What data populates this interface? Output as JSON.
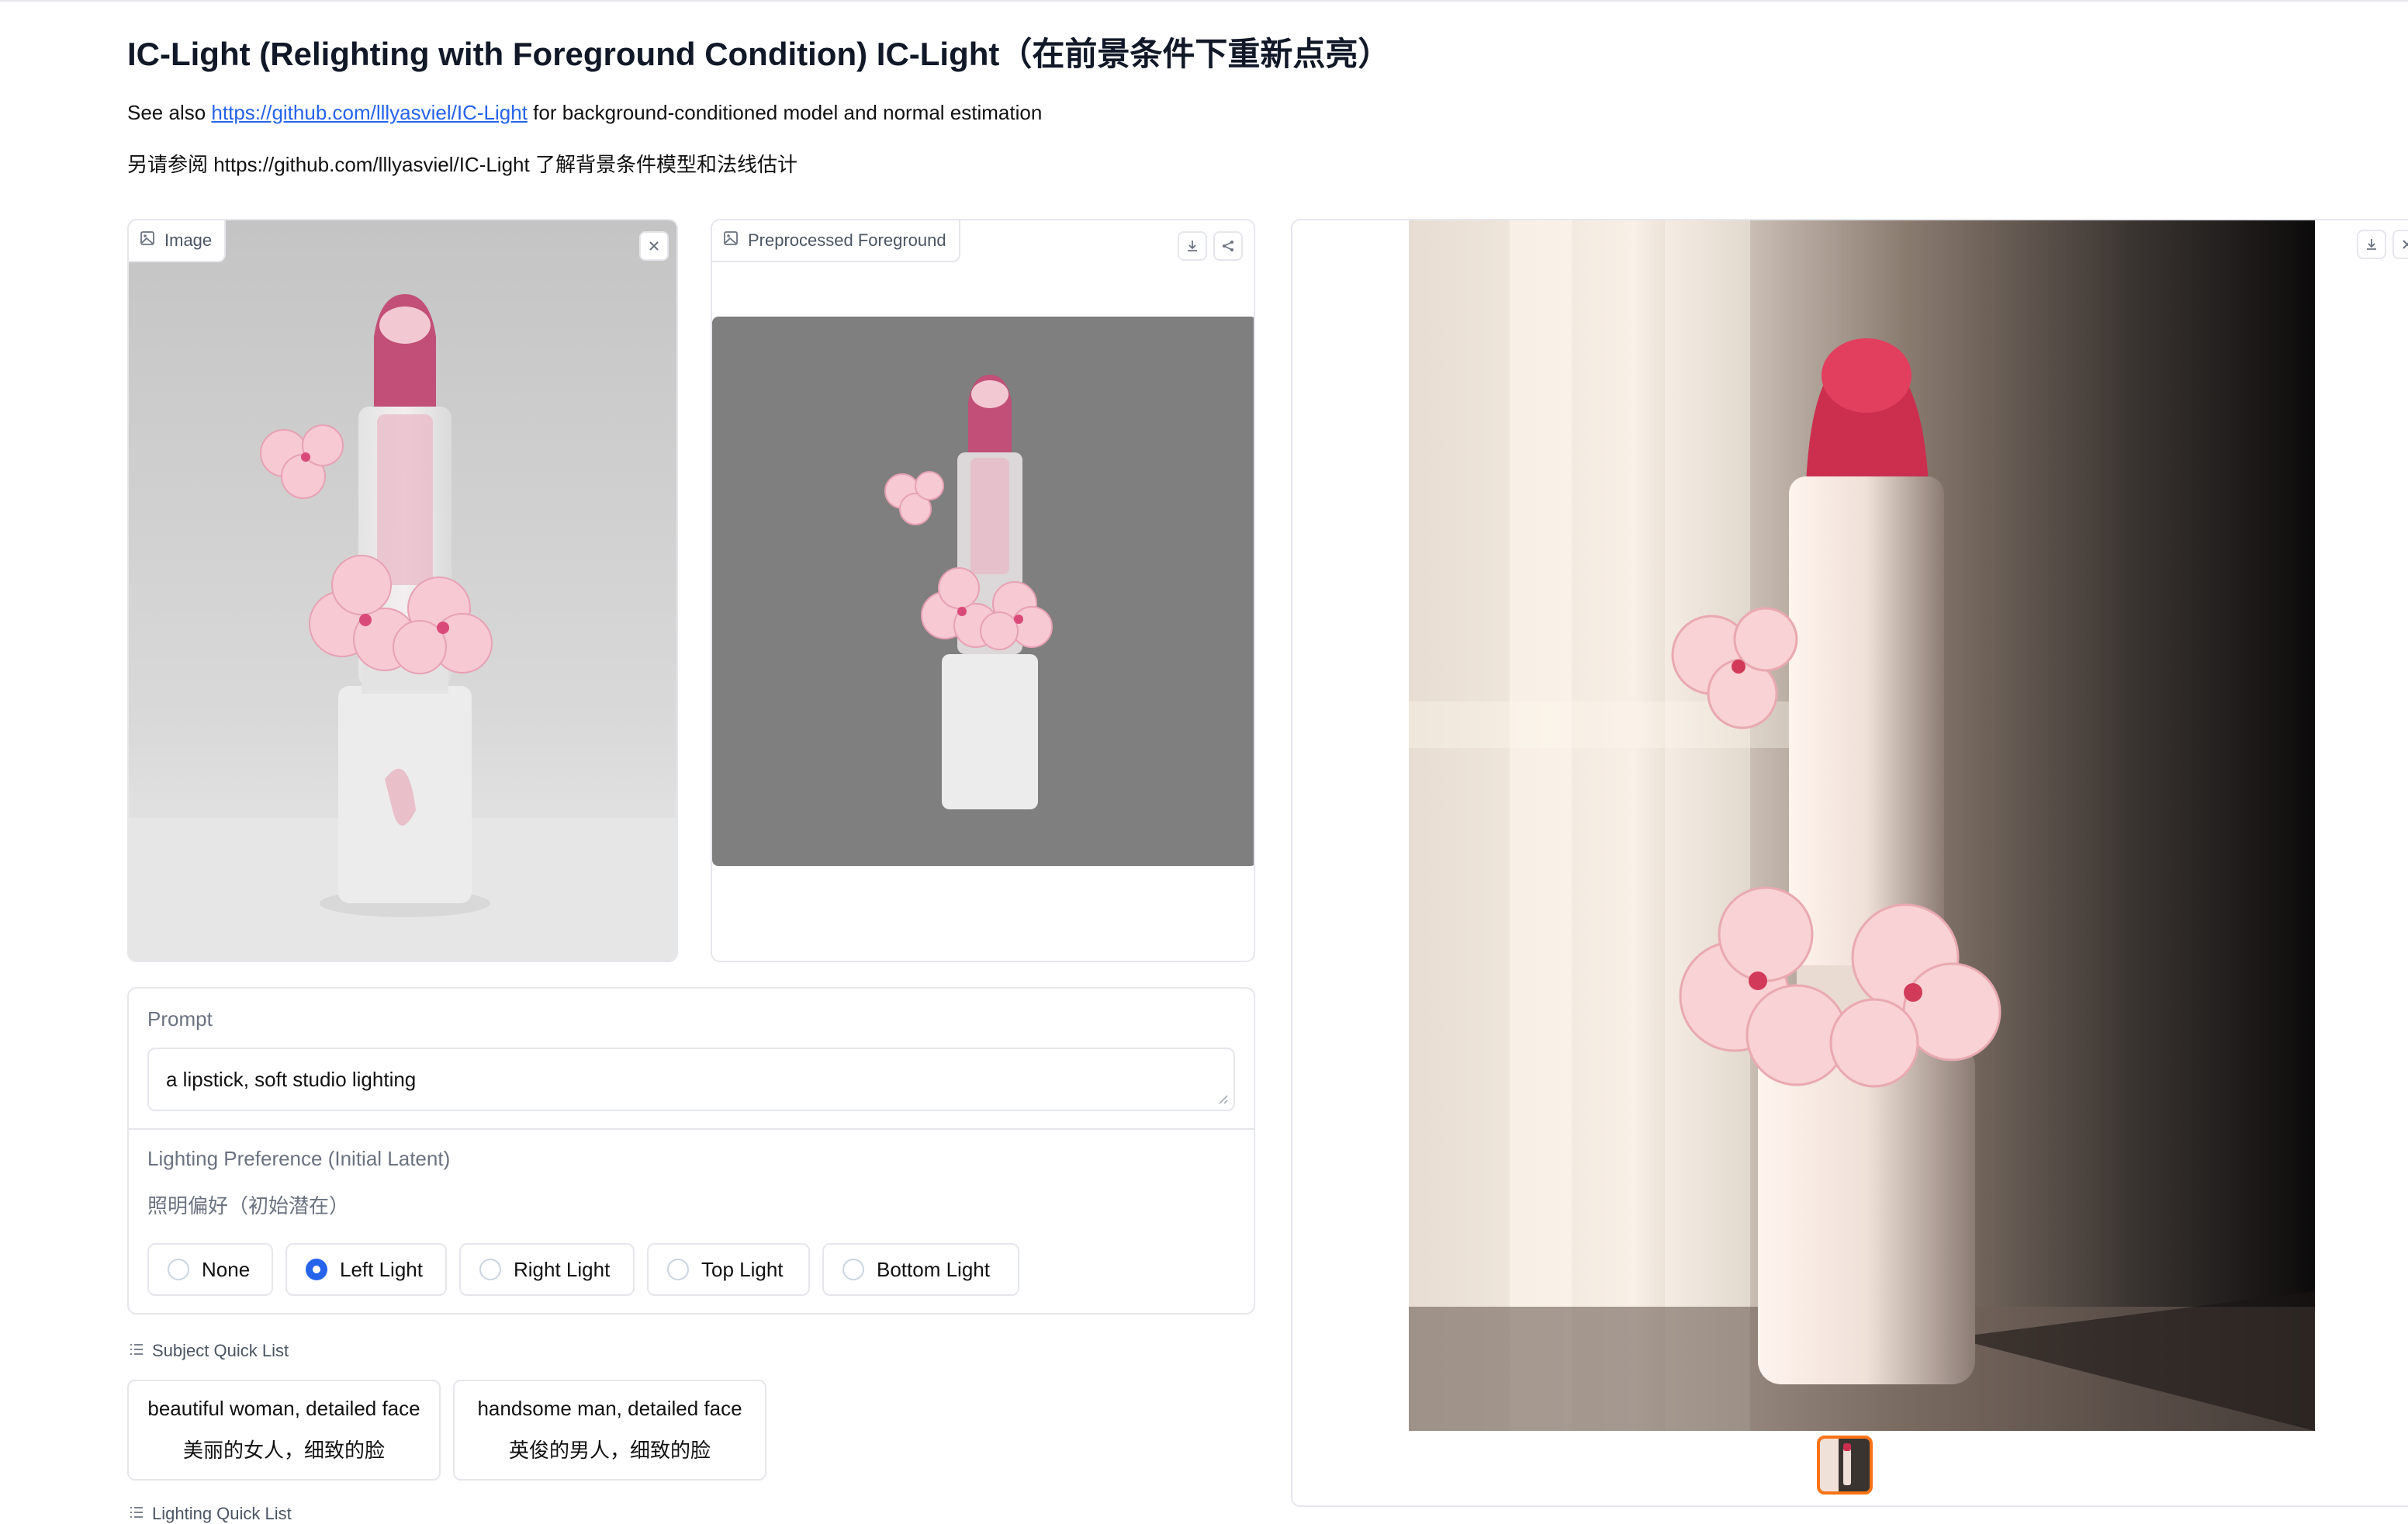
{
  "header": {
    "title": "IC-Light (Relighting with Foreground Condition) IC-Light（在前景条件下重新点亮）",
    "see_also_prefix": "See also ",
    "see_also_link": "https://github.com/lllyasviel/IC-Light",
    "see_also_suffix": " for background-conditioned model and normal estimation",
    "cn_line": "另请参阅 https://github.com/lllyasviel/IC-Light 了解背景条件模型和法线估计"
  },
  "image_panel": {
    "label": "Image",
    "icon": "image-icon",
    "close_icon": "close-icon"
  },
  "preprocessed_panel": {
    "label": "Preprocessed Foreground",
    "icon": "image-icon",
    "download_icon": "download-icon",
    "share_icon": "share-icon"
  },
  "output_panel": {
    "download_icon": "download-icon",
    "close_icon": "close-icon"
  },
  "prompt": {
    "label": "Prompt",
    "value": "a lipstick, soft studio lighting"
  },
  "lighting": {
    "label": "Lighting Preference (Initial Latent)",
    "label_cn": "照明偏好（初始潜在）",
    "options": [
      "None",
      "Left Light",
      "Right Light",
      "Top Light",
      "Bottom Light"
    ],
    "selected": "Left Light"
  },
  "subject_quick_list": {
    "label": "Subject Quick List",
    "items": [
      {
        "en": "beautiful woman, detailed face",
        "cn": "美丽的女人，细致的脸"
      },
      {
        "en": "handsome man, detailed face",
        "cn": "英俊的男人，细致的脸"
      }
    ]
  },
  "lighting_quick_list": {
    "label": "Lighting Quick List"
  },
  "colors": {
    "accent": "#2563eb",
    "thumb_border": "#f97316",
    "preprocess_bg": "#7f7f7f"
  }
}
